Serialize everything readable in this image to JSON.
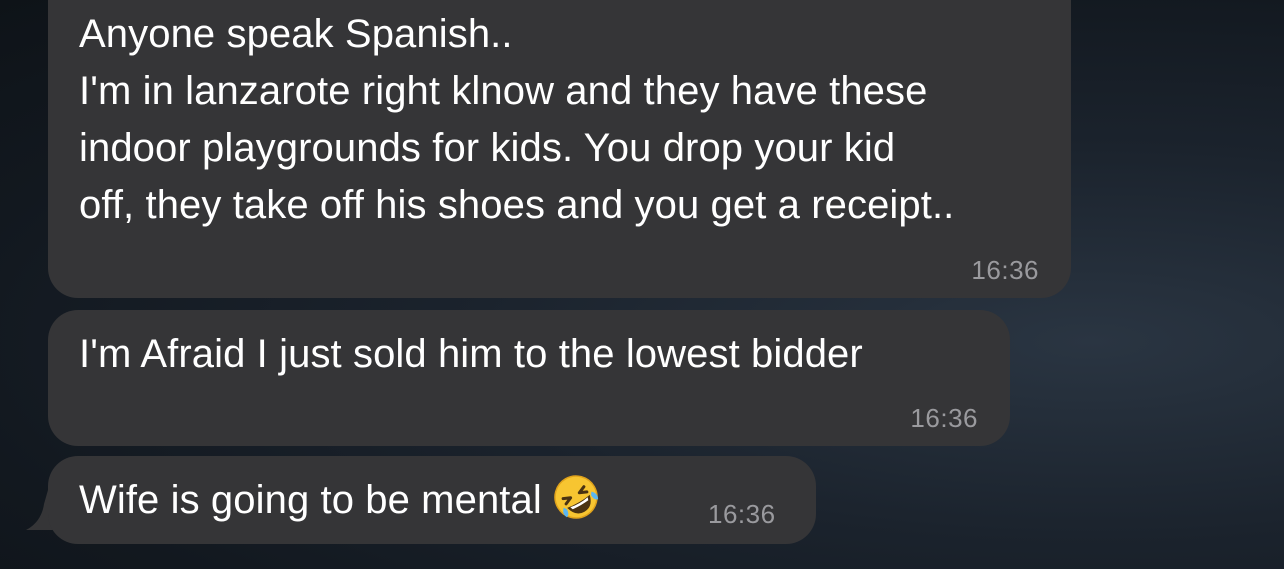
{
  "messages": [
    {
      "text": "Anyone speak Spanish..\nI'm in lanzarote right klnow and they have these\nindoor playgrounds for kids. You drop your kid\noff, they take off his shoes and you get a receipt..",
      "time": "16:36"
    },
    {
      "text": "I'm Afraid I just sold him to the lowest bidder",
      "time": "16:36"
    },
    {
      "text": "Wife is going to be mental",
      "emoji": "rolling-on-floor-laughing-emoji",
      "time": "16:36"
    }
  ],
  "colors": {
    "bubble": "#353537",
    "text": "#ffffff",
    "timestamp": "#9a9a9e",
    "emoji_face": "#f7c531"
  }
}
